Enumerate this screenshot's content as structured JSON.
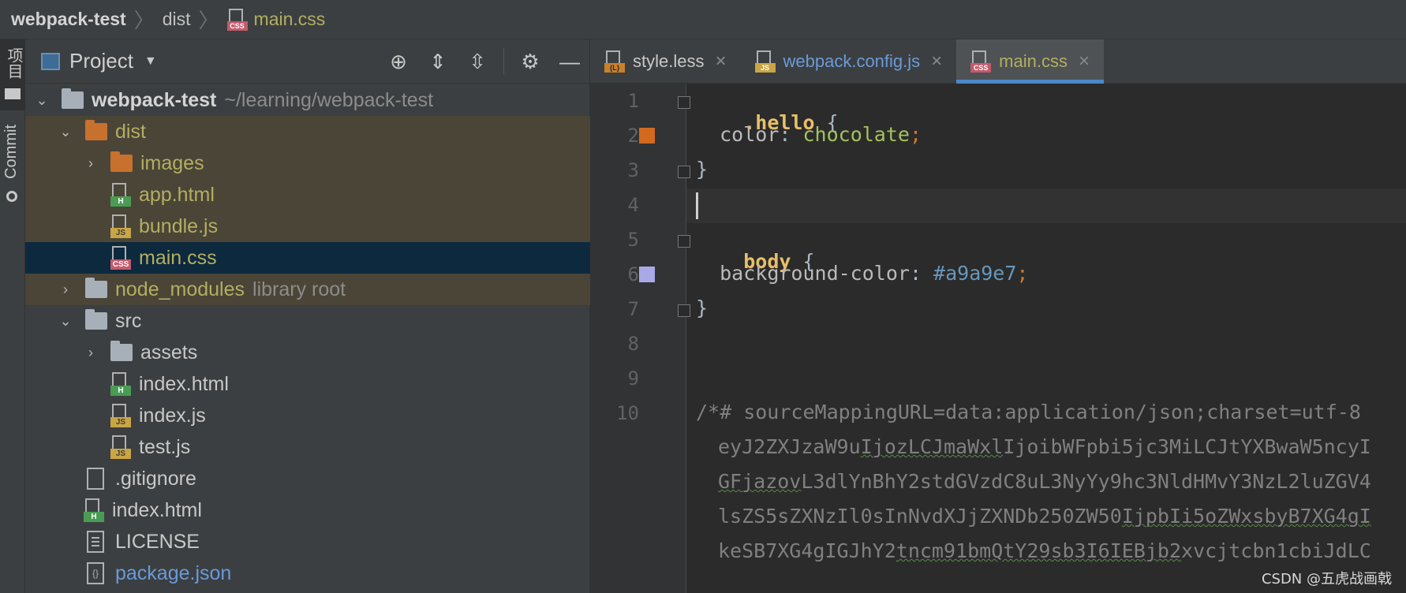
{
  "breadcrumb": {
    "project": "webpack-test",
    "folder": "dist",
    "file": "main.css"
  },
  "toolstrip": {
    "project_label": "项目",
    "commit_label": "Commit"
  },
  "project_panel": {
    "title": "Project",
    "tree": [
      {
        "name": "webpack-test",
        "extra": "~/learning/webpack-test"
      },
      {
        "name": "dist"
      },
      {
        "name": "images"
      },
      {
        "name": "app.html",
        "badge": "H"
      },
      {
        "name": "bundle.js",
        "badge": "JS"
      },
      {
        "name": "main.css",
        "badge": "CSS"
      },
      {
        "name": "node_modules",
        "extra": "library root"
      },
      {
        "name": "src"
      },
      {
        "name": "assets"
      },
      {
        "name": "index.html",
        "badge": "H"
      },
      {
        "name": "index.js",
        "badge": "JS"
      },
      {
        "name": "test.js",
        "badge": "JS"
      },
      {
        "name": ".gitignore"
      },
      {
        "name": "index.html",
        "badge": "H"
      },
      {
        "name": "LICENSE"
      },
      {
        "name": "package.json"
      }
    ]
  },
  "tabs": [
    {
      "label": "style.less",
      "badge": "{L}"
    },
    {
      "label": "webpack.config.js",
      "badge": "JS"
    },
    {
      "label": "main.css",
      "badge": "CSS"
    }
  ],
  "editor": {
    "line_numbers": [
      "1",
      "2",
      "3",
      "4",
      "5",
      "6",
      "7",
      "8",
      "9",
      "10"
    ],
    "code": {
      "l1_selector": ".hello",
      "l1_brace": "{",
      "l2_prop": "color",
      "l2_value": "chocolate",
      "l3_brace": "}",
      "l5_selector": "body",
      "l5_brace": "{",
      "l6_prop": "background-color",
      "l6_value": "#a9a9e7",
      "l7_brace": "}",
      "l10": "/*# sourceMappingURL=data:application/json;charset=utf-8",
      "wrap1_a": "eyJ2ZXJzaW9u",
      "wrap1_b": "IjozLCJmaWxl",
      "wrap1_c": "IjoibWFpbi5jc3MiLCJtYXBwaW5ncyI",
      "wrap2_a": "GFjazov",
      "wrap2_b": "L3dlYnBhY2stdGVzdC8uL3NyYy9hc3NldHMvY3NzL2luZGV4",
      "wrap3_a": "lsZS5sZXNzIl0sInNvdXJjZXNDb250ZW50",
      "wrap3_b": "IjpbIi5oZWxsbyB7XG4gI",
      "wrap4_a": "keSB7XG4gIGJhY2",
      "wrap4_b": "tncm91bmQtY29sb3I6IEBjb2",
      "wrap4_c": "xvcjtcbn1cbiJdLC"
    },
    "swatch_colors": {
      "line2": "#d2691e",
      "line6": "#a9a9e7"
    }
  },
  "watermark": "CSDN @五虎战画戟",
  "colors": {
    "accent": "#4a88c7",
    "excluded_bg": "#4b4538",
    "selected_bg": "#0d293e"
  }
}
